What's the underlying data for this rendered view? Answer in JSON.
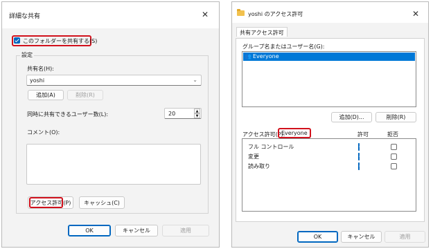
{
  "left": {
    "title": "詳細な共有",
    "share_checkbox_label": "このフォルダーを共有する(S)",
    "settings_group": "設定",
    "share_name_label": "共有名(H):",
    "share_name_value": "yoshi",
    "add_button": "追加(A)",
    "remove_button": "削除(R)",
    "user_limit_label": "同時に共有できるユーザー数(L):",
    "user_limit_value": "20",
    "comment_label": "コメント(O):",
    "permissions_button": "アクセス許可",
    "permissions_button_suffix": "(P)",
    "caching_button": "キャッシュ(C)",
    "ok": "OK",
    "cancel": "キャンセル",
    "apply": "適用"
  },
  "right": {
    "title": "yoshi のアクセス許可",
    "tab": "共有アクセス許可",
    "group_label": "グループ名またはユーザー名(G):",
    "users": [
      "Everyone"
    ],
    "add_button": "追加(D)...",
    "remove_button": "削除(R)",
    "perm_label_prefix": "アクセス許可(P):",
    "perm_label_user": "Everyone",
    "allow_header": "許可",
    "deny_header": "拒否",
    "permissions": [
      {
        "name": "フル コントロール",
        "allow": true,
        "deny": false
      },
      {
        "name": "変更",
        "allow": true,
        "deny": false
      },
      {
        "name": "読み取り",
        "allow": true,
        "deny": false
      }
    ],
    "ok": "OK",
    "cancel": "キャンセル",
    "apply": "適用"
  },
  "colors": {
    "accent": "#0067c0",
    "highlight_red": "#d1111c",
    "selection": "#0078d7"
  }
}
